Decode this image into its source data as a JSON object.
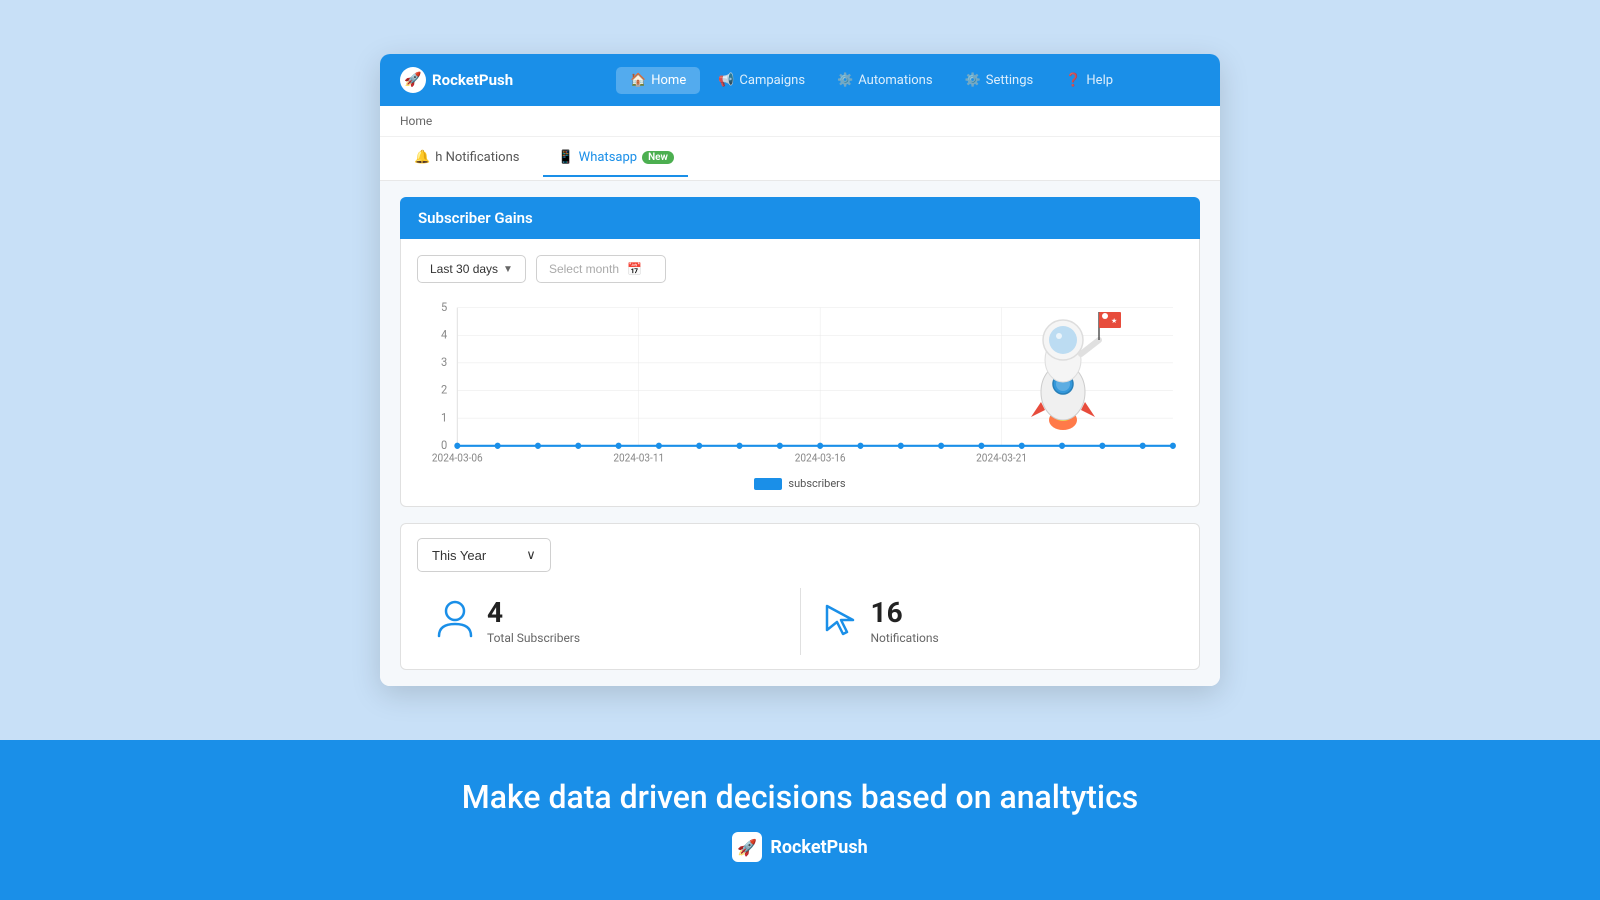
{
  "app": {
    "name": "RocketPush",
    "logo_emoji": "🚀"
  },
  "nav": {
    "links": [
      {
        "id": "home",
        "label": "Home",
        "icon": "🏠",
        "active": true
      },
      {
        "id": "campaigns",
        "label": "Campaigns",
        "icon": "📢",
        "active": false
      },
      {
        "id": "automations",
        "label": "Automations",
        "icon": "⚙️",
        "active": false
      },
      {
        "id": "settings",
        "label": "Settings",
        "icon": "⚙️",
        "active": false
      },
      {
        "id": "help",
        "label": "Help",
        "icon": "❓",
        "active": false
      }
    ]
  },
  "breadcrumb": {
    "text": "Home"
  },
  "tabs": [
    {
      "id": "push-notifications",
      "label": "h Notifications",
      "icon": "🔔",
      "active": false
    },
    {
      "id": "whatsapp",
      "label": "Whatsapp",
      "icon": "📱",
      "active": true,
      "badge": "New"
    }
  ],
  "subscriber_gains": {
    "title": "Subscriber Gains",
    "time_filter": {
      "label": "Last 30 days",
      "chevron": "▼"
    },
    "month_picker": {
      "placeholder": "Select month",
      "icon": "📅"
    },
    "chart": {
      "y_axis": [
        0,
        1,
        2,
        3,
        4,
        5
      ],
      "x_axis": [
        "2024-03-06",
        "2024-03-11",
        "2024-03-16",
        "2024-03-21"
      ],
      "data_line": "flat at 0",
      "legend_label": "subscribers"
    }
  },
  "stats": {
    "time_filter": {
      "label": "This Year",
      "chevron": "∨"
    },
    "items": [
      {
        "id": "total-subscribers",
        "icon": "👤",
        "value": "4",
        "label": "Total Subscribers"
      },
      {
        "id": "notifications",
        "icon": "🖱️",
        "value": "16",
        "label": "Notifications"
      }
    ]
  },
  "footer": {
    "tagline": "Make data driven decisions based on analtytics",
    "brand_name": "RocketPush",
    "brand_icon": "🚀"
  }
}
